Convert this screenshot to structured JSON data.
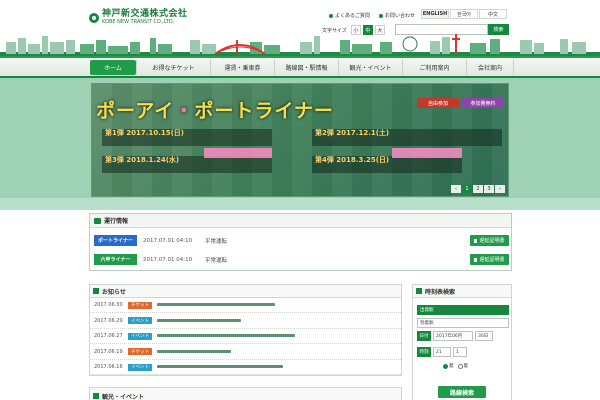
{
  "header": {
    "logo_ja": "神戸新交通株式会社",
    "logo_en": "KOBE NEW TRANSIT CO.,LTD.",
    "top_links": [
      "よくあるご質問",
      "お問い合わせ"
    ],
    "languages": [
      "ENGLISH",
      "한국어",
      "中文"
    ],
    "font_size_label": "文字サイズ",
    "font_sizes": [
      "小",
      "中",
      "大"
    ],
    "search_button": "検索"
  },
  "nav": {
    "items": [
      "ホーム",
      "お得なチケット",
      "運賃・乗車券",
      "路線図・駅情報",
      "観光・イベント",
      "ご利用案内",
      "会社案内"
    ]
  },
  "slider": {
    "title_a": "ポーアイ",
    "title_b": "・",
    "title_c": "ポートライナー",
    "tags": [
      "自由参加",
      "参加費無料"
    ],
    "events": [
      {
        "date": "第1弾 2017.10.15(日)"
      },
      {
        "date": "第2弾 2017.12.1(土)"
      },
      {
        "date": "第3弾 2018.1.24(水)"
      },
      {
        "date": "第4弾 2018.3.25(日)"
      }
    ],
    "pager": [
      "1",
      "2",
      "3"
    ],
    "colors": {
      "title": "#f6e04a",
      "tag_free": "#c0392b",
      "tag_join": "#8e44ad"
    }
  },
  "train_info": {
    "title": "運行情報",
    "lines": [
      {
        "name": "ポートライナー",
        "time": "2017.07.01 04:10",
        "message": "平常運転",
        "cert": "遅延証明書",
        "color": "#2a6bc8"
      },
      {
        "name": "六甲ライナー",
        "time": "2017.07.01 04:10",
        "message": "平常運転",
        "cert": "遅延証明書",
        "color": "#1f9b49"
      }
    ]
  },
  "news": {
    "title": "お知らせ",
    "items": [
      {
        "date": "2017.06.30",
        "category": "チケット",
        "cat_color": "#e06a2a",
        "stub": 118
      },
      {
        "date": "2017.06.29",
        "category": "イベント",
        "cat_color": "#2aa0c8",
        "stub": 84
      },
      {
        "date": "2017.06.27",
        "category": "イベント",
        "cat_color": "#2aa0c8",
        "stub": 138
      },
      {
        "date": "2017.06.19",
        "category": "チケット",
        "cat_color": "#e06a2a",
        "stub": 74
      },
      {
        "date": "2017.06.16",
        "category": "イベント",
        "cat_color": "#2aa0c8",
        "stub": 126
      }
    ],
    "second_title": "観光・イベント"
  },
  "timetable": {
    "title": "時刻表検索",
    "depart_label": "出発駅",
    "arrive_label": "到着駅",
    "date_label": "日付",
    "date_value": "2017年06月",
    "day_value": "30日",
    "time_label": "時刻",
    "hour_value": "21",
    "minute_value": "1",
    "radio_depart": "発",
    "radio_arrive": "着",
    "search_button": "路線検索"
  }
}
